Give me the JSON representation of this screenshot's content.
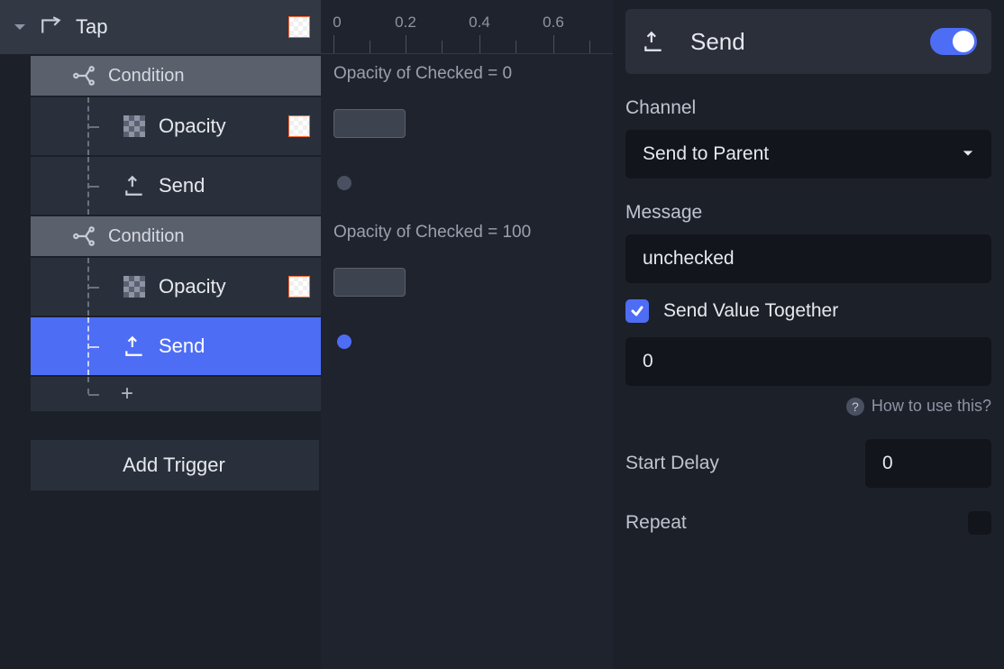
{
  "tree": {
    "trigger_label": "Tap",
    "items": [
      {
        "type": "condition",
        "label": "Condition",
        "summary": "Opacity of Checked = 0"
      },
      {
        "type": "opacity",
        "label": "Opacity"
      },
      {
        "type": "send",
        "label": "Send"
      },
      {
        "type": "condition",
        "label": "Condition",
        "summary": "Opacity of Checked = 100"
      },
      {
        "type": "opacity",
        "label": "Opacity"
      },
      {
        "type": "send",
        "label": "Send",
        "selected": true
      }
    ],
    "add_trigger_label": "Add Trigger"
  },
  "timeline": {
    "ticks": [
      "0",
      "0.2",
      "0.4",
      "0.6"
    ]
  },
  "inspector": {
    "header_label": "Send",
    "toggle_on": true,
    "channel_label": "Channel",
    "channel_value": "Send to Parent",
    "message_label": "Message",
    "message_value": "unchecked",
    "send_value_together_label": "Send Value Together",
    "send_value_together_checked": true,
    "value_field": "0",
    "help_label": "How to use this?",
    "start_delay_label": "Start Delay",
    "start_delay_value": "0",
    "repeat_label": "Repeat",
    "repeat_checked": false
  }
}
